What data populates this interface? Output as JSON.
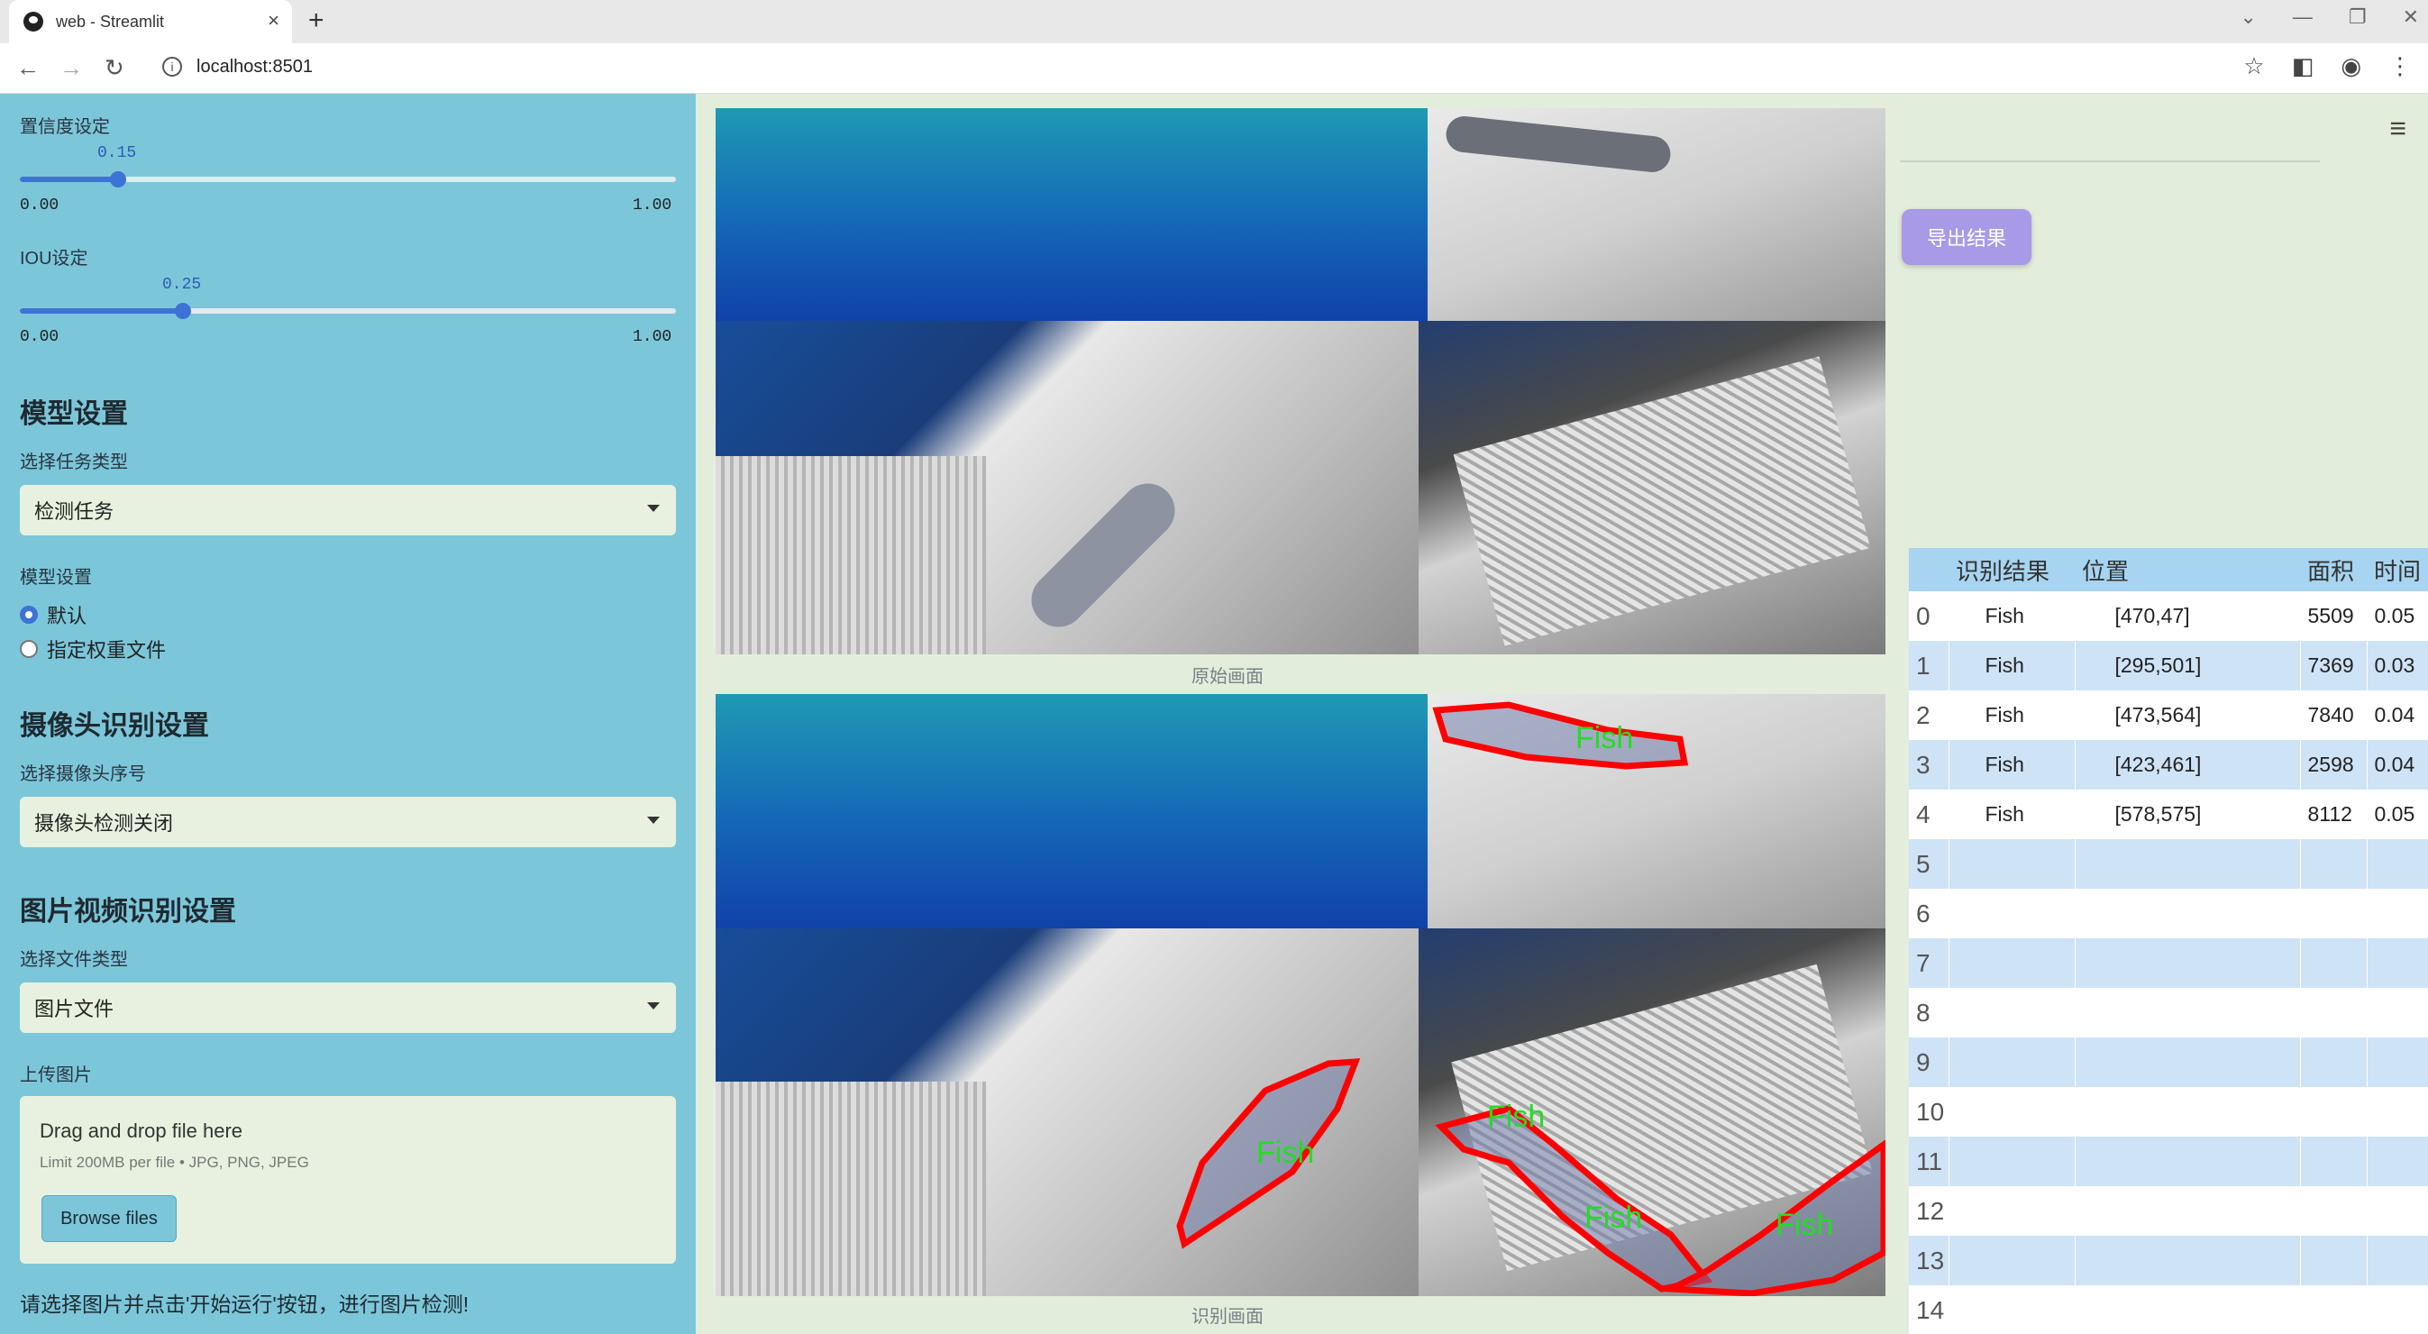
{
  "browser": {
    "tab_title": "web - Streamlit",
    "url": "localhost:8501",
    "tab_close": "×",
    "new_tab": "+",
    "win_min": "—",
    "win_restore": "❐",
    "win_close": "✕",
    "chevron": "⌄"
  },
  "sidebar": {
    "confidence": {
      "label": "置信度设定",
      "value": "0.15",
      "min": "0.00",
      "max": "1.00",
      "fraction": 0.15
    },
    "iou": {
      "label": "IOU设定",
      "value": "0.25",
      "min": "0.00",
      "max": "1.00",
      "fraction": 0.25
    },
    "model_heading": "模型设置",
    "task_label": "选择任务类型",
    "task_value": "检测任务",
    "model_label": "模型设置",
    "model_options": [
      "默认",
      "指定权重文件"
    ],
    "model_selected": 0,
    "camera_heading": "摄像头识别设置",
    "camera_label": "选择摄像头序号",
    "camera_value": "摄像头检测关闭",
    "file_heading": "图片视频识别设置",
    "file_type_label": "选择文件类型",
    "file_type_value": "图片文件",
    "upload_label": "上传图片",
    "upload_title": "Drag and drop file here",
    "upload_limit": "Limit 200MB per file • JPG, PNG, JPEG",
    "browse_label": "Browse files",
    "hint": "请选择图片并点击'开始运行'按钮，进行图片检测!"
  },
  "main": {
    "original_caption": "原始画面",
    "detect_caption": "识别画面",
    "export_label": "导出结果",
    "detection_label": "Fish"
  },
  "table": {
    "headers": [
      "",
      "识别结果",
      "位置",
      "面积",
      "时间"
    ],
    "rows": [
      {
        "idx": "0",
        "result": "Fish",
        "pos": "[470,47]",
        "area": "5509",
        "time": "0.05"
      },
      {
        "idx": "1",
        "result": "Fish",
        "pos": "[295,501]",
        "area": "7369",
        "time": "0.03"
      },
      {
        "idx": "2",
        "result": "Fish",
        "pos": "[473,564]",
        "area": "7840",
        "time": "0.04"
      },
      {
        "idx": "3",
        "result": "Fish",
        "pos": "[423,461]",
        "area": "2598",
        "time": "0.04"
      },
      {
        "idx": "4",
        "result": "Fish",
        "pos": "[578,575]",
        "area": "8112",
        "time": "0.05"
      },
      {
        "idx": "5",
        "result": "",
        "pos": "",
        "area": "",
        "time": ""
      },
      {
        "idx": "6",
        "result": "",
        "pos": "",
        "area": "",
        "time": ""
      },
      {
        "idx": "7",
        "result": "",
        "pos": "",
        "area": "",
        "time": ""
      },
      {
        "idx": "8",
        "result": "",
        "pos": "",
        "area": "",
        "time": ""
      },
      {
        "idx": "9",
        "result": "",
        "pos": "",
        "area": "",
        "time": ""
      },
      {
        "idx": "10",
        "result": "",
        "pos": "",
        "area": "",
        "time": ""
      },
      {
        "idx": "11",
        "result": "",
        "pos": "",
        "area": "",
        "time": ""
      },
      {
        "idx": "12",
        "result": "",
        "pos": "",
        "area": "",
        "time": ""
      },
      {
        "idx": "13",
        "result": "",
        "pos": "",
        "area": "",
        "time": ""
      },
      {
        "idx": "14",
        "result": "",
        "pos": "",
        "area": "",
        "time": ""
      }
    ]
  },
  "colors": {
    "sidebar": "#7cc6da",
    "main_bg": "#e3eddb",
    "accent": "#3d73d6",
    "detect_box": "#ff0000",
    "detect_text": "#22dd22"
  }
}
